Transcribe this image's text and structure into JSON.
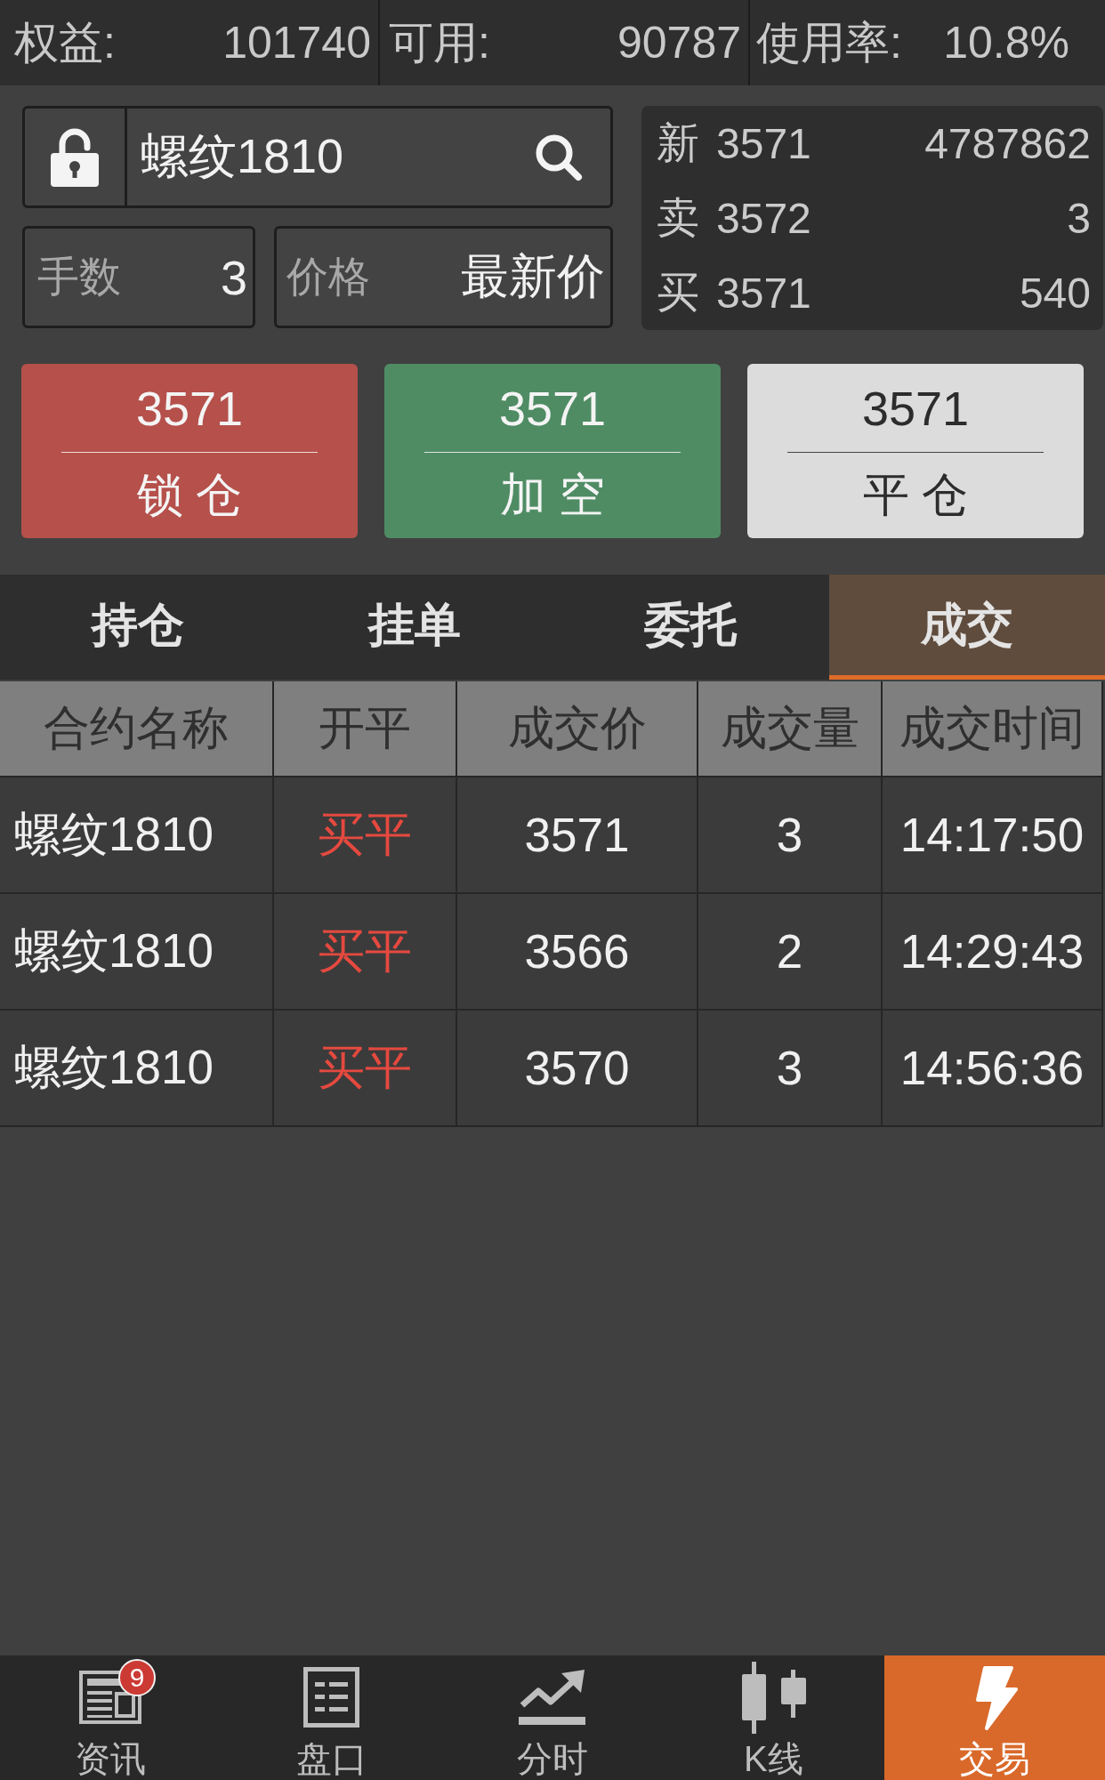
{
  "account_bar": [
    {
      "label": "权益:",
      "value": "101740"
    },
    {
      "label": "可用:",
      "value": "90787"
    },
    {
      "label": "使用率:",
      "value": "10.8%"
    }
  ],
  "contract_search": {
    "value": "螺纹1810",
    "locked": false
  },
  "order_fields": [
    {
      "label": "手数",
      "value": "3"
    },
    {
      "label": "价格",
      "value": "最新价"
    }
  ],
  "quote": [
    {
      "label": "新",
      "price": "3571",
      "volume": "4787862"
    },
    {
      "label": "卖",
      "price": "3572",
      "volume": "3"
    },
    {
      "label": "买",
      "price": "3571",
      "volume": "540"
    }
  ],
  "actions": [
    {
      "kind": "lock",
      "price": "3571",
      "label": "锁 仓"
    },
    {
      "kind": "short",
      "price": "3571",
      "label": "加 空"
    },
    {
      "kind": "close",
      "price": "3571",
      "label": "平 仓"
    }
  ],
  "tabs": [
    {
      "label": "持仓",
      "selected": false
    },
    {
      "label": "挂单",
      "selected": false
    },
    {
      "label": "委托",
      "selected": false
    },
    {
      "label": "成交",
      "selected": true
    }
  ],
  "table": {
    "columns": [
      "合约名称",
      "开平",
      "成交价",
      "成交量",
      "成交时间"
    ],
    "rows": [
      {
        "contract": "螺纹1810",
        "open_close": "买平",
        "buy": true,
        "price": "3571",
        "volume": "3",
        "time": "14:17:50"
      },
      {
        "contract": "螺纹1810",
        "open_close": "买平",
        "buy": true,
        "price": "3566",
        "volume": "2",
        "time": "14:29:43"
      },
      {
        "contract": "螺纹1810",
        "open_close": "买平",
        "buy": true,
        "price": "3570",
        "volume": "3",
        "time": "14:56:36"
      }
    ]
  },
  "bottom_nav": [
    {
      "kind": "news",
      "label": "资讯",
      "badge": "9",
      "selected": false
    },
    {
      "kind": "quotes",
      "label": "盘口",
      "selected": false
    },
    {
      "kind": "intraday",
      "label": "分时",
      "selected": false
    },
    {
      "kind": "kline",
      "label": "K线",
      "selected": false
    },
    {
      "kind": "trade",
      "label": "交易",
      "selected": true
    }
  ]
}
